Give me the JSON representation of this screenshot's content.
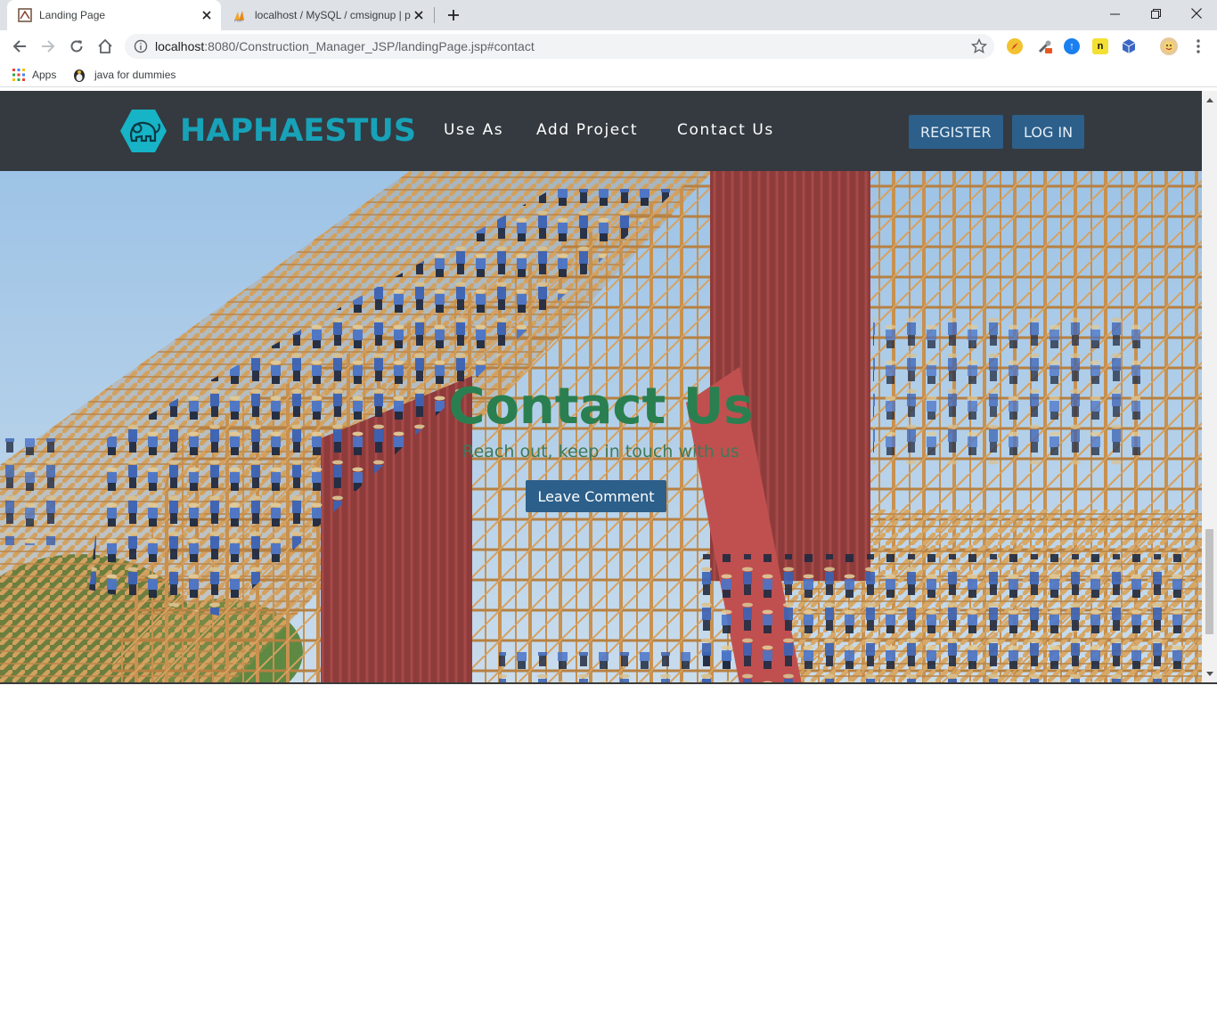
{
  "browser": {
    "tabs": [
      {
        "title": "Landing Page",
        "active": true
      },
      {
        "title": "localhost / MySQL / cmsignup | p",
        "active": false
      }
    ],
    "url_host": "localhost",
    "url_rest": ":8080/Construction_Manager_JSP/landingPage.jsp#contact",
    "bookmarks": [
      {
        "label": "Apps",
        "icon": "apps-grid-icon"
      },
      {
        "label": "java for dummies",
        "icon": "java-duke-icon"
      }
    ],
    "colors": {
      "tabstrip": "#dee1e6",
      "omnibox": "#f1f3f4"
    }
  },
  "site": {
    "brand": "HAPHAESTUS",
    "nav": {
      "links": [
        "Use As",
        "Add Project",
        "Contact Us"
      ],
      "register": "REGISTER",
      "login": "LOG IN"
    },
    "hero": {
      "title": "Contact Us",
      "subtitle": "Reach out, keep in touch with us",
      "button": "Leave Comment"
    },
    "colors": {
      "navbar": "#343a40",
      "brand": "#17a2b8",
      "button": "#2c5f8a",
      "hero_title": "#2a7f50"
    }
  }
}
